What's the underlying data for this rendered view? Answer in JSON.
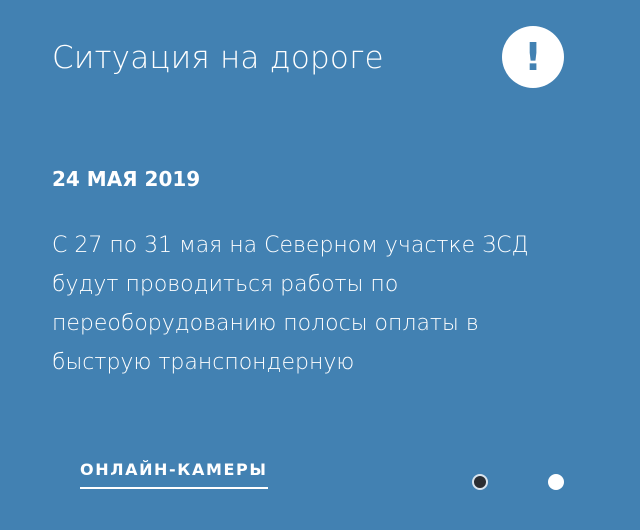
{
  "widget": {
    "title": "Ситуация на дороге",
    "alert_icon_glyph": "!",
    "alert_icon_name": "exclamation-icon"
  },
  "news": {
    "date": "24 МАЯ 2019",
    "text": "С 27 по 31 мая на Северном участке ЗСД будут проводиться работы по переоборудованию полосы оплаты в быструю транспондерную"
  },
  "footer": {
    "cameras_link_label": "ОНЛАЙН-КАМЕРЫ"
  },
  "pager": {
    "total": 2,
    "active_index": 0
  },
  "colors": {
    "background": "#4281b2",
    "text": "#ffffff",
    "active_dot": "#2b2e33",
    "inactive_dot": "#ffffff"
  }
}
